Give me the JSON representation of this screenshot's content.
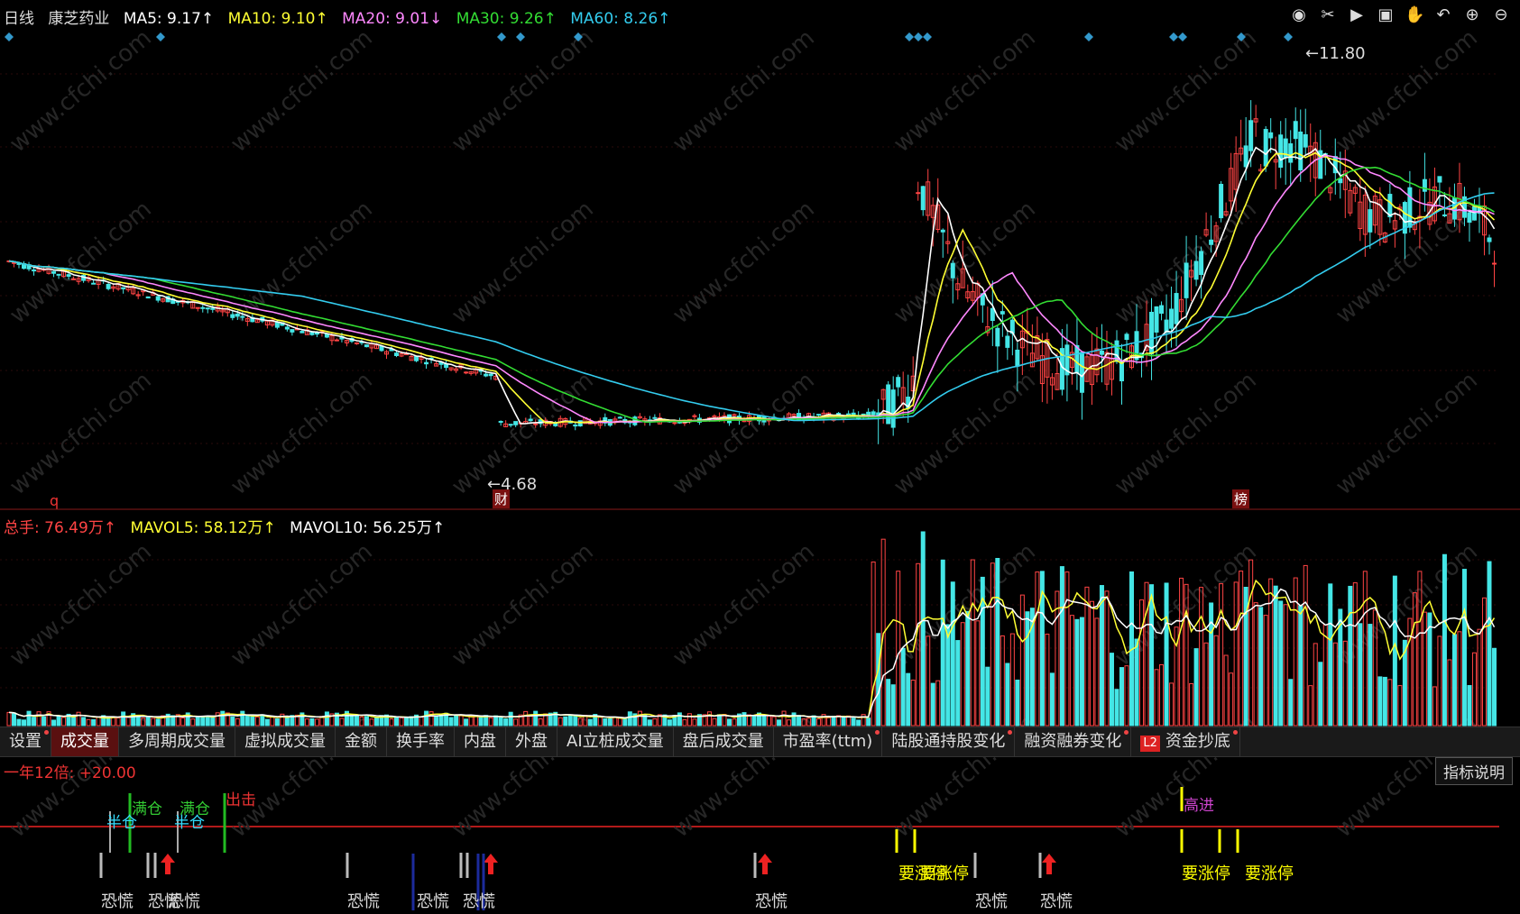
{
  "header": {
    "period": "日线",
    "stock": "康芝药业",
    "ma": [
      {
        "label": "MA5: 9.17↑",
        "color": "#ffffff"
      },
      {
        "label": "MA10: 9.10↑",
        "color": "#ffff33"
      },
      {
        "label": "MA20: 9.01↓",
        "color": "#ff88ff"
      },
      {
        "label": "MA30: 9.26↑",
        "color": "#33dd33"
      },
      {
        "label": "MA60: 8.26↑",
        "color": "#33ccee"
      }
    ]
  },
  "toolbar": [
    "eye-icon",
    "scissors-icon",
    "play-icon",
    "lock-icon",
    "hand-icon",
    "undo-icon",
    "plus-icon",
    "minus-icon"
  ],
  "price_annotations": {
    "high": "11.80",
    "low": "4.68",
    "marker_q": "q",
    "marker_cai": "财",
    "marker_bang": "榜"
  },
  "volume_header": [
    {
      "label": "总手: 76.49万↑",
      "color": "#ff4444"
    },
    {
      "label": "MAVOL5: 58.12万↑",
      "color": "#ffff33"
    },
    {
      "label": "MAVOL10: 56.25万↑",
      "color": "#ffffff"
    }
  ],
  "tabs": [
    "设置",
    "成交量",
    "多周期成交量",
    "虚拟成交量",
    "金额",
    "换手率",
    "内盘",
    "外盘",
    "AI立桩成交量",
    "盘后成交量",
    "市盈率(ttm)",
    "陆股通持股变化",
    "融资融券变化",
    "资金抄底"
  ],
  "tab_l2": "L2",
  "active_tab": "成交量",
  "indicator": {
    "title": "一年12倍: +20.00",
    "explain_button": "指标说明",
    "labels": [
      "半仓",
      "满仓",
      "半仓",
      "满仓",
      "出击",
      "高进",
      "恐慌",
      "恐慌",
      "恐慌",
      "恐慌",
      "恐慌",
      "恐慌",
      "恐慌",
      "恐慌",
      "恐慌",
      "要涨停",
      "要涨停",
      "要涨停",
      "要涨停"
    ]
  },
  "chart_data": {
    "type": "candlestick",
    "price_range": [
      4.68,
      11.8
    ],
    "volume_unit": "万"
  },
  "watermark": "www.cfchi.com"
}
